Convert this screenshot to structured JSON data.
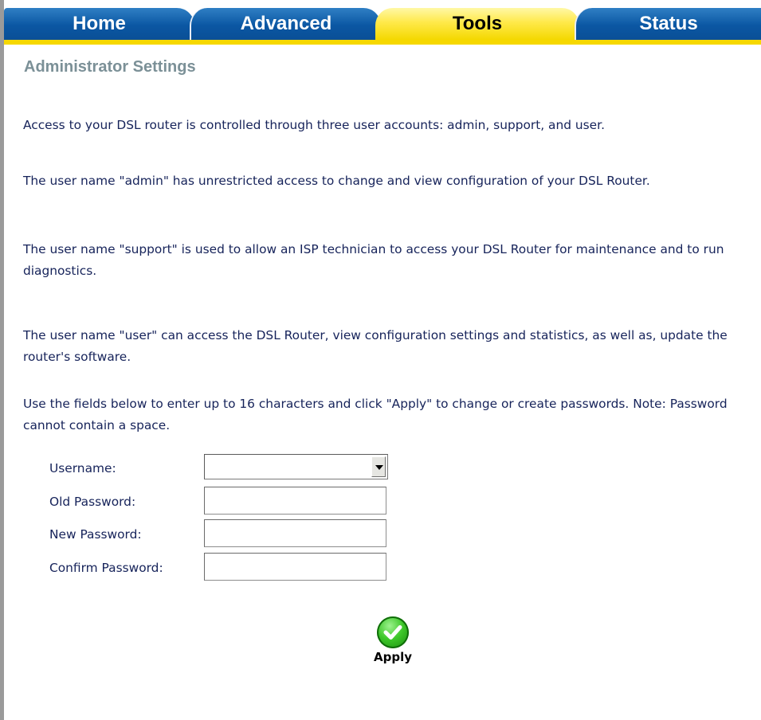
{
  "tabs": [
    {
      "label": "Home",
      "active": false
    },
    {
      "label": "Advanced",
      "active": false
    },
    {
      "label": "Tools",
      "active": true
    },
    {
      "label": "Status",
      "active": false
    }
  ],
  "page": {
    "title": "Administrator Settings",
    "paragraphs": [
      "Access to your DSL router is controlled through three user accounts: admin, support, and user.",
      "The user name \"admin\" has unrestricted access to change and view configuration of your DSL Router.",
      "The user name \"support\" is used to allow an ISP technician to access your DSL Router for maintenance and to run diagnostics.",
      "The user name \"user\" can access the DSL Router, view configuration settings and statistics, as well as, update the router's software.",
      "Use the fields below to enter up to 16 characters and click \"Apply\" to change or create passwords. Note: Password cannot contain a space."
    ]
  },
  "form": {
    "username_label": "Username:",
    "username_value": "",
    "old_password_label": "Old Password:",
    "old_password_value": "",
    "new_password_label": "New Password:",
    "new_password_value": "",
    "confirm_password_label": "Confirm Password:",
    "confirm_password_value": ""
  },
  "apply": {
    "label": "Apply",
    "icon": "checkmark-icon"
  },
  "colors": {
    "tab_blue": "#0b57a3",
    "tab_active_yellow": "#ffe94a",
    "title_gray": "#7b9097",
    "body_text": "#16235a",
    "apply_green": "#3ec72a"
  }
}
